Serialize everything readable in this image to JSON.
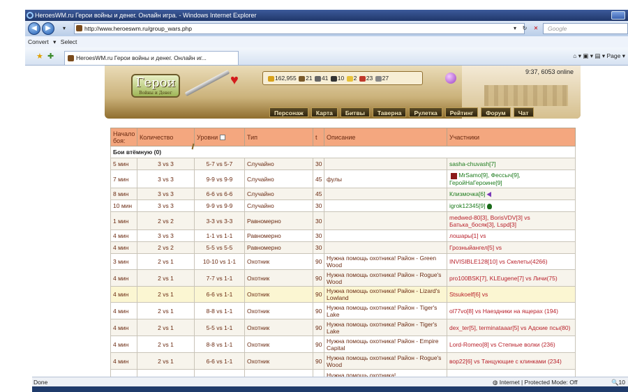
{
  "browser": {
    "title": "HeroesWM.ru Герои войны и денег. Онлайн игра. - Windows Internet Explorer",
    "url": "http://www.heroeswm.ru/group_wars.php",
    "search_placeholder": "Google",
    "toolbar_convert": "Convert",
    "toolbar_select": "Select",
    "tab_title": "HeroesWM.ru Герои войны и денег. Онлайн иг...",
    "page_menu": "Page",
    "status_left": "Done",
    "status_zone": "Internet | Protected Mode: Off",
    "zoom": "10"
  },
  "header": {
    "logo": "Герои",
    "logo_sub": "Войны и Денег",
    "online": "9:37, 6053 online",
    "resources": [
      "162,955",
      "21",
      "41",
      "10",
      "2",
      "23",
      "27"
    ],
    "menu": [
      "Персонаж",
      "Карта",
      "Битвы",
      "Таверна",
      "Рулетка",
      "Рейтинг",
      "Форум",
      "Чат"
    ]
  },
  "table": {
    "headers": [
      "Начало боя:",
      "Количество",
      "Уровни",
      "Тип",
      "t",
      "Описание",
      "Участники"
    ],
    "section": "Бои втёмную (0)",
    "rows": [
      {
        "start": "5 мин",
        "count": "3 vs 3",
        "levels": "5-7 vs 5-7",
        "type": "Случайно",
        "t": "30",
        "desc": "",
        "parts": "sasha-chuvash[7]"
      },
      {
        "start": "7 мин",
        "count": "3 vs 3",
        "levels": "9-9 vs 9-9",
        "type": "Случайно",
        "t": "45",
        "desc": "фулы",
        "parts": "MrSamo[9], Фессыч[9], ГеройНаГероине[9]"
      },
      {
        "start": "8 мин",
        "count": "3 vs 3",
        "levels": "6-6 vs 6-6",
        "type": "Случайно",
        "t": "45",
        "desc": "",
        "parts": "Клизмочка[6]"
      },
      {
        "start": "10 мин",
        "count": "3 vs 3",
        "levels": "9-9 vs 9-9",
        "type": "Случайно",
        "t": "30",
        "desc": "",
        "parts": "igrok12345[9]"
      },
      {
        "start": "1 мин",
        "count": "2 vs 2",
        "levels": "3-3 vs 3-3",
        "type": "Равномерно",
        "t": "30",
        "desc": "",
        "parts": "medwed-80[3], BorisVDV[3] vs Батька_босяк[3], Lspd[3]"
      },
      {
        "start": "4 мин",
        "count": "3 vs 3",
        "levels": "1-1 vs 1-1",
        "type": "Равномерно",
        "t": "30",
        "desc": "",
        "parts": "лошары[1] vs"
      },
      {
        "start": "4 мин",
        "count": "2 vs 2",
        "levels": "5-5 vs 5-5",
        "type": "Равномерно",
        "t": "30",
        "desc": "",
        "parts": "Грозныйангел[5] vs"
      },
      {
        "start": "3 мин",
        "count": "2 vs 1",
        "levels": "10-10 vs 1-1",
        "type": "Охотник",
        "t": "90",
        "desc": "Нужна помощь охотника! Район - Green Wood",
        "parts": "INVISIBLE128[10] vs Скелеты(4266)"
      },
      {
        "start": "4 мин",
        "count": "2 vs 1",
        "levels": "7-7 vs 1-1",
        "type": "Охотник",
        "t": "90",
        "desc": "Нужна помощь охотника! Район - Rogue's Wood",
        "parts": "pro100BSK[7], KLEugene[7] vs Личи(75)"
      },
      {
        "start": "4 мин",
        "count": "2 vs 1",
        "levels": "6-6 vs 1-1",
        "type": "Охотник",
        "t": "90",
        "desc": "Нужна помощь охотника! Район - Lizard's Lowland",
        "parts": "Stsukoelf[6] vs"
      },
      {
        "start": "4 мин",
        "count": "2 vs 1",
        "levels": "8-8 vs 1-1",
        "type": "Охотник",
        "t": "90",
        "desc": "Нужна помощь охотника! Район - Tiger's Lake",
        "parts": "ol77vo[8] vs Наездники на ящерах (194)"
      },
      {
        "start": "4 мин",
        "count": "2 vs 1",
        "levels": "5-5 vs 1-1",
        "type": "Охотник",
        "t": "90",
        "desc": "Нужна помощь охотника! Район - Tiger's Lake",
        "parts": "dex_ter[5], terminataaar[5] vs Адские псы(80)"
      },
      {
        "start": "4 мин",
        "count": "2 vs 1",
        "levels": "8-8 vs 1-1",
        "type": "Охотник",
        "t": "90",
        "desc": "Нужна помощь охотника! Район - Empire Capital",
        "parts": "Lord-Romeo[8] vs Степные волки (236)"
      },
      {
        "start": "4 мин",
        "count": "2 vs 1",
        "levels": "6-6 vs 1-1",
        "type": "Охотник",
        "t": "90",
        "desc": "Нужна помощь охотника! Район - Rogue's Wood",
        "parts": "вор22[6] vs Танцующие с клинками (234)"
      },
      {
        "start": "",
        "count": "",
        "levels": "",
        "type": "",
        "t": "",
        "desc": "Нужна помощь охотника!",
        "parts": ""
      }
    ]
  }
}
